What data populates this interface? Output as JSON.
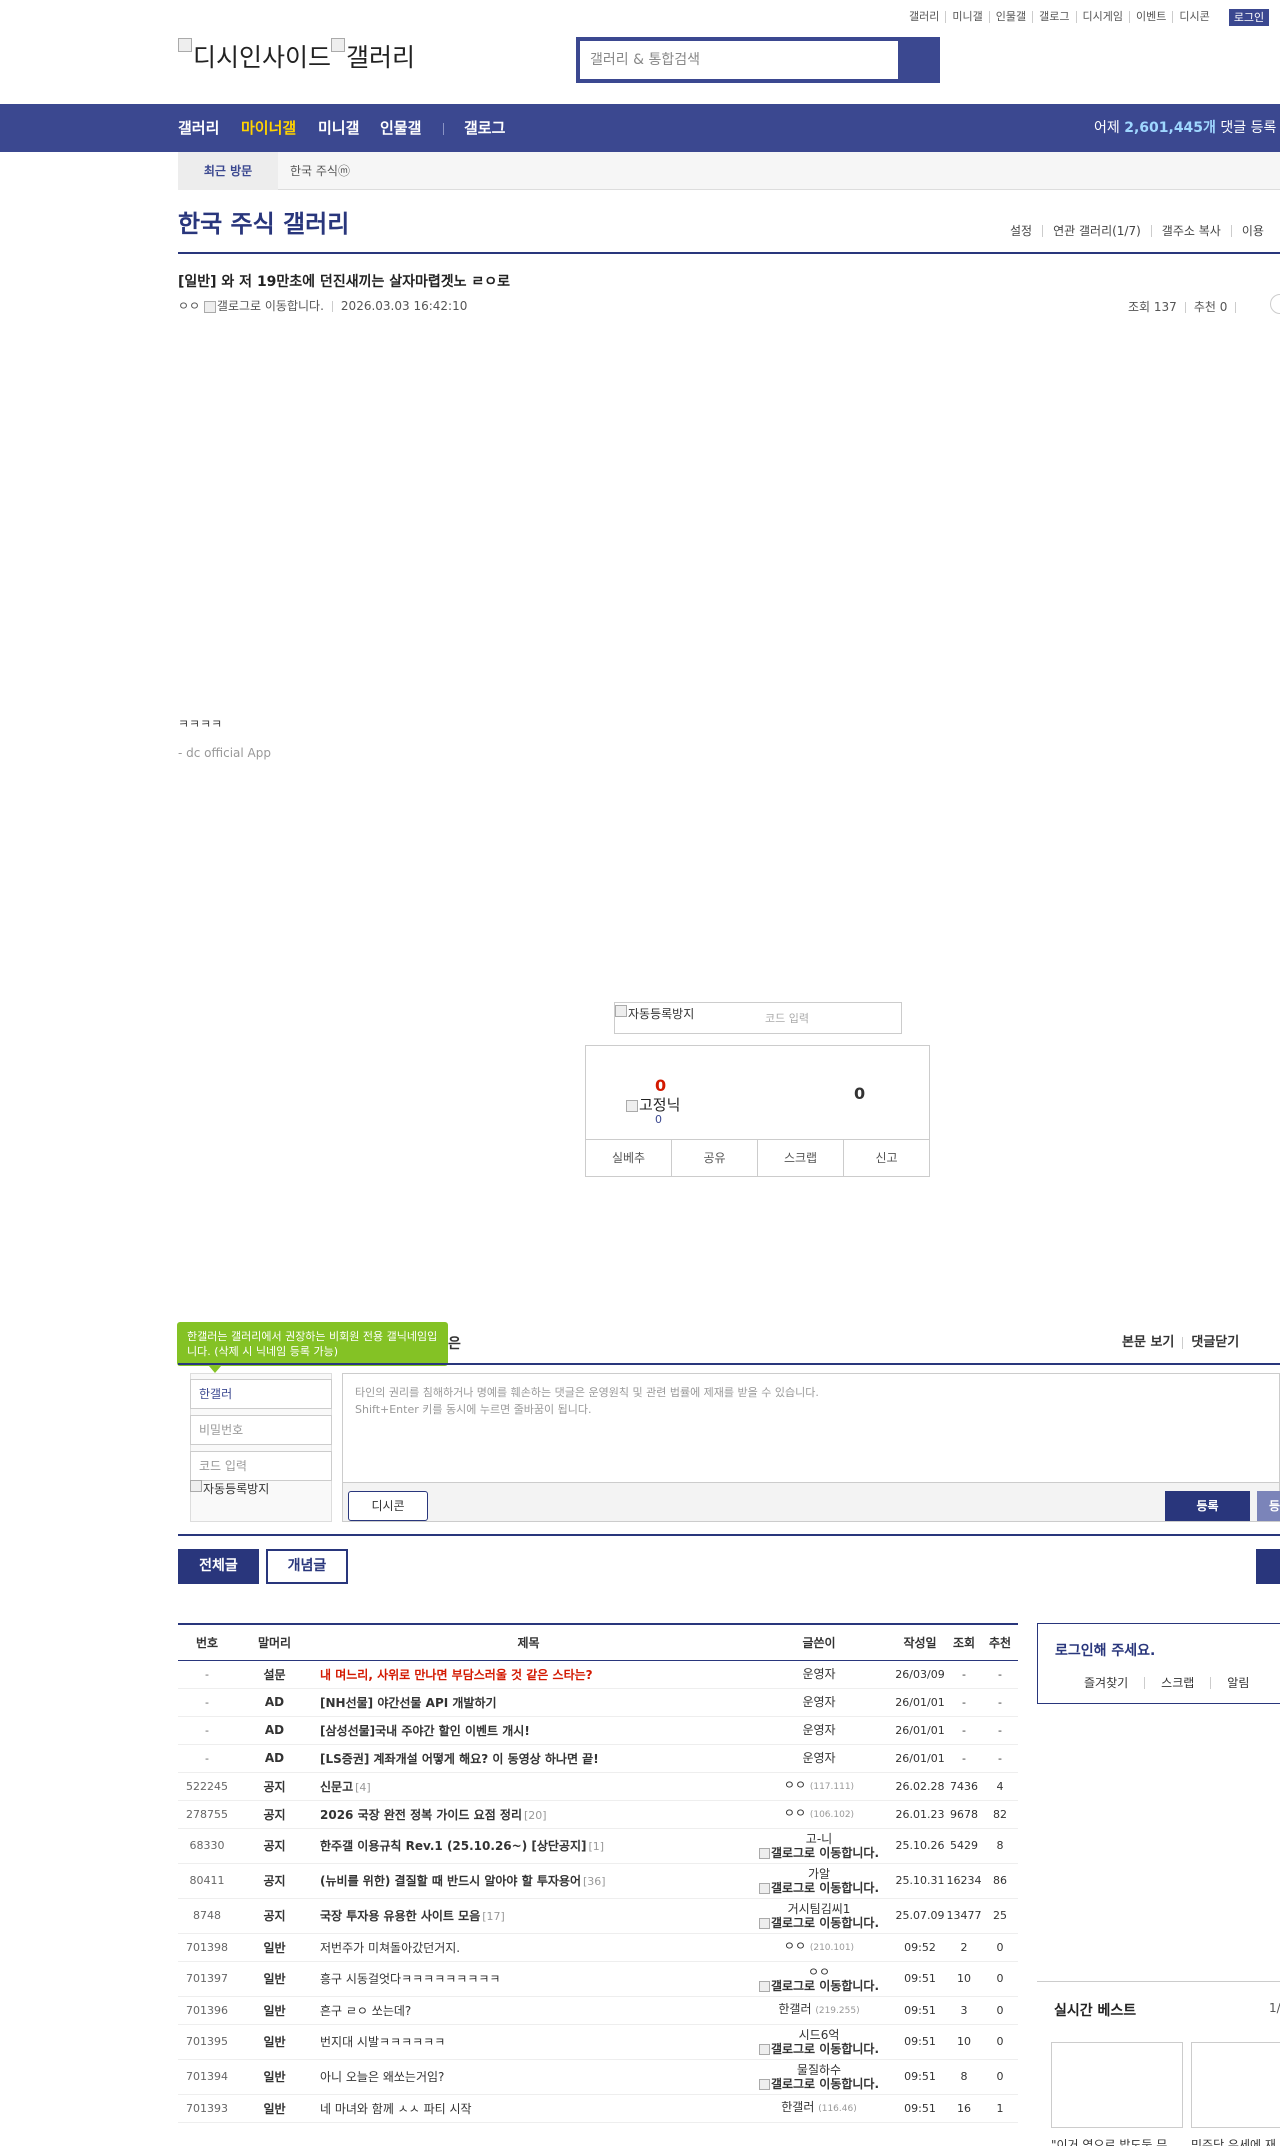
{
  "top_util": {
    "links": [
      "갤러리",
      "미니갤",
      "인물갤",
      "갤로그",
      "디시게임",
      "이벤트",
      "디시콘"
    ],
    "login": "로그인"
  },
  "header": {
    "logo_alt": "디시인사이드",
    "logo_alt2": "갤러리",
    "search_placeholder": "갤러리 & 통합검색"
  },
  "nav": {
    "items": [
      "갤러리",
      "마이너갤",
      "미니갤",
      "인물갤",
      "갤로그"
    ],
    "active_index": 1,
    "right_prefix": "어제",
    "right_count": "2,601,445개",
    "right_suffix": "댓글 등록"
  },
  "recent": {
    "title": "최근 방문",
    "item": "한국 주식ⓜ"
  },
  "gallery": {
    "title": "한국 주식 갤러리",
    "tools": [
      "설정",
      "연관 갤러리(1/7)",
      "갤주소 복사",
      "이용"
    ]
  },
  "post": {
    "title": "[일반] 와 저 19만초에 던진새끼는 살자마렵겟노 ㄹㅇ로",
    "author": "ㅇㅇ",
    "gallog_alt": "갤로그로 이동합니다.",
    "datetime": "2026.03.03 16:42:10",
    "views": "조회 137",
    "recommend": "추천 0",
    "body": "ㅋㅋㅋㅋ",
    "signature": "- dc official App"
  },
  "captcha": {
    "img_alt": "자동등록방지",
    "placeholder": "코드 입력"
  },
  "recommend": {
    "up": "0",
    "gonick_alt": "고정닉",
    "gonick_count": "0",
    "down": "0",
    "actions": [
      "실베추",
      "공유",
      "스크랩",
      "신고"
    ]
  },
  "comment": {
    "tooltip": "한갤러는 갤러리에서 권장하는 비회원 전용 갤닉네임입니다. (삭제 시 닉네임 등록 가능)",
    "tooltip_tail": "은",
    "tools": [
      "본문 보기",
      "댓글닫기"
    ],
    "nick_value": "한갤러",
    "password_placeholder": "비밀번호",
    "code_placeholder": "코드 입력",
    "captcha_alt": "자동등록방지",
    "textarea_line1": "타인의 권리를 침해하거나 명예를 훼손하는 댓글은 운영원칙 및 관련 법률에 제재를 받을 수 있습니다.",
    "textarea_line2": "Shift+Enter 키를 동시에 누르면 줄바꿈이 됩니다.",
    "dccon": "디시콘",
    "submit": "등록",
    "submit2": "등록"
  },
  "tabs": {
    "all": "전체글",
    "concept": "개념글"
  },
  "table": {
    "headers": [
      "번호",
      "말머리",
      "제목",
      "글쓴이",
      "작성일",
      "조회",
      "추천"
    ],
    "rows": [
      {
        "num": "-",
        "head": "설문",
        "subject": "내 며느리, 사위로 만나면 부담스러울 것 같은 스타는?",
        "reply": "",
        "writer": "운영자",
        "ip": "",
        "date": "26/03/09",
        "views": "-",
        "rec": "-",
        "style": "red"
      },
      {
        "num": "-",
        "head": "AD",
        "subject": "[NH선물] 야간선물 API 개발하기",
        "reply": "",
        "writer": "운영자",
        "ip": "",
        "date": "26/01/01",
        "views": "-",
        "rec": "-",
        "style": "bold"
      },
      {
        "num": "-",
        "head": "AD",
        "subject": "[삼성선물]국내 주야간 할인 이벤트 개시!",
        "reply": "",
        "writer": "운영자",
        "ip": "",
        "date": "26/01/01",
        "views": "-",
        "rec": "-",
        "style": "bold"
      },
      {
        "num": "-",
        "head": "AD",
        "subject": "[LS증권] 계좌개설 어떻게 해요? 이 동영상 하나면 끝!",
        "reply": "",
        "writer": "운영자",
        "ip": "",
        "date": "26/01/01",
        "views": "-",
        "rec": "-",
        "style": "bold"
      },
      {
        "num": "522245",
        "head": "공지",
        "subject": "신문고",
        "reply": "[4]",
        "writer": "ㅇㅇ",
        "ip": "(117.111)",
        "date": "26.02.28",
        "views": "7436",
        "rec": "4",
        "style": "bold"
      },
      {
        "num": "278755",
        "head": "공지",
        "subject": "2026 국장 완전 정복 가이드 요점 정리",
        "reply": "[20]",
        "writer": "ㅇㅇ",
        "ip": "(106.102)",
        "date": "26.01.23",
        "views": "9678",
        "rec": "82",
        "style": "bold"
      },
      {
        "num": "68330",
        "head": "공지",
        "subject": "한주갤 이용규칙 Rev.1 (25.10.26~) [상단공지]",
        "reply": "[1]",
        "writer": "고-니",
        "ip": "",
        "gallog": "갤로그로 이동합니다.",
        "date": "25.10.26",
        "views": "5429",
        "rec": "8",
        "style": "bold"
      },
      {
        "num": "80411",
        "head": "공지",
        "subject": "(뉴비를 위한) 결질할 때 반드시 알아야 할 투자용어",
        "reply": "[36]",
        "writer": "가알",
        "ip": "",
        "gallog": "갤로그로 이동합니다.",
        "date": "25.10.31",
        "views": "16234",
        "rec": "86",
        "style": "bold"
      },
      {
        "num": "8748",
        "head": "공지",
        "subject": "국장 투자용 유용한 사이트 모음",
        "reply": "[17]",
        "writer": "거시팀김씨1",
        "ip": "",
        "gallog": "갤로그로 이동합니다.",
        "date": "25.07.09",
        "views": "13477",
        "rec": "25",
        "style": "bold"
      },
      {
        "num": "701398",
        "head": "일반",
        "subject": "저번주가 미쳐돌아갔던거지.",
        "reply": "",
        "writer": "ㅇㅇ",
        "ip": "(210.101)",
        "date": "09:52",
        "views": "2",
        "rec": "0",
        "style": "plain"
      },
      {
        "num": "701397",
        "head": "일반",
        "subject": "흥구 시동걸엇다ㅋㅋㅋㅋㅋㅋㅋㅋㅋ",
        "reply": "",
        "writer": "ㅇㅇ",
        "ip": "",
        "gallog": "갤로그로 이동합니다.",
        "date": "09:51",
        "views": "10",
        "rec": "0",
        "style": "plain"
      },
      {
        "num": "701396",
        "head": "일반",
        "subject": "흔구 ㄹㅇ 쏘는데?",
        "reply": "",
        "writer": "한갤러",
        "ip": "(219.255)",
        "date": "09:51",
        "views": "3",
        "rec": "0",
        "style": "plain"
      },
      {
        "num": "701395",
        "head": "일반",
        "subject": "번지대 시발ㅋㅋㅋㅋㅋㅋ",
        "reply": "",
        "writer": "시드6억",
        "ip": "",
        "gallog": "갤로그로 이동합니다.",
        "date": "09:51",
        "views": "10",
        "rec": "0",
        "style": "plain"
      },
      {
        "num": "701394",
        "head": "일반",
        "subject": "아니 오늘은 왜쏘는거임?",
        "reply": "",
        "writer": "물질하수",
        "ip": "",
        "gallog": "갤로그로 이동합니다.",
        "date": "09:51",
        "views": "8",
        "rec": "0",
        "style": "plain"
      },
      {
        "num": "701393",
        "head": "일반",
        "subject": "네 마녀와 함께 ㅅㅅ 파티 시작",
        "reply": "",
        "writer": "한갤러",
        "ip": "(116.46)",
        "date": "09:51",
        "views": "16",
        "rec": "1",
        "style": "plain"
      }
    ]
  },
  "login_box": {
    "title": "로그인해 주세요.",
    "links": [
      "즐겨찾기",
      "스크랩",
      "알림"
    ]
  },
  "best": {
    "title": "실시간 베스트",
    "page": "1/",
    "captions": [
      "\"이거 역으로 밥도둑 무",
      "민주당 유세에 재"
    ]
  }
}
